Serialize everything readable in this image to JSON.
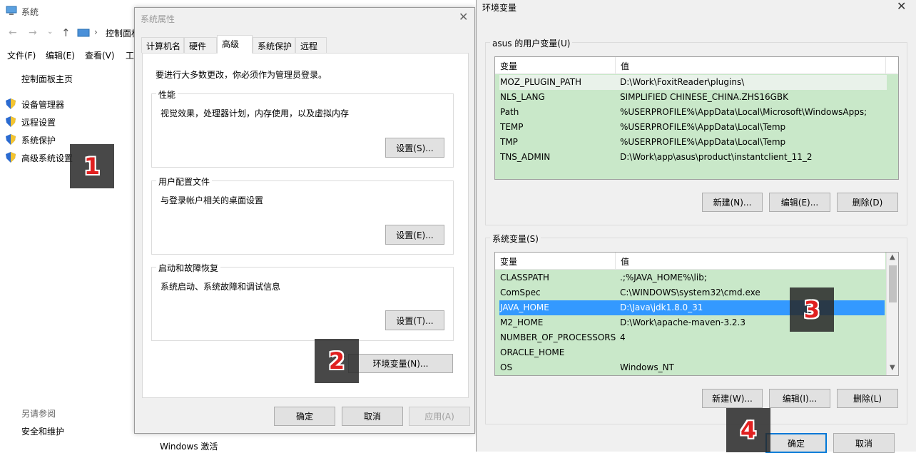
{
  "control_panel": {
    "window_title": "系统",
    "address": "控制面板",
    "menu": [
      "文件(F)",
      "编辑(E)",
      "查看(V)",
      "工"
    ],
    "home_link": "控制面板主页",
    "links": [
      "设备管理器",
      "远程设置",
      "系统保护",
      "高级系统设置"
    ],
    "see_also": "另请参阅",
    "security": "安全和维护",
    "activation": "Windows 激活"
  },
  "system_properties": {
    "title": "系统属性",
    "tabs": [
      "计算机名",
      "硬件",
      "高级",
      "系统保护",
      "远程"
    ],
    "active_tab": "高级",
    "admin_note": "要进行大多数更改，你必须作为管理员登录。",
    "performance": {
      "title": "性能",
      "desc": "视觉效果，处理器计划，内存使用，以及虚拟内存",
      "button": "设置(S)..."
    },
    "user_profile": {
      "title": "用户配置文件",
      "desc": "与登录帐户相关的桌面设置",
      "button": "设置(E)..."
    },
    "startup": {
      "title": "启动和故障恢复",
      "desc": "系统启动、系统故障和调试信息",
      "button": "设置(T)..."
    },
    "env_button": "环境变量(N)...",
    "ok": "确定",
    "cancel": "取消",
    "apply": "应用(A)"
  },
  "env_vars": {
    "title": "环境变量",
    "user_section": "asus 的用户变量(U)",
    "col_var": "变量",
    "col_val": "值",
    "user_rows": [
      {
        "name": "MOZ_PLUGIN_PATH",
        "value": "D:\\Work\\FoxitReader\\plugins\\"
      },
      {
        "name": "NLS_LANG",
        "value": "SIMPLIFIED CHINESE_CHINA.ZHS16GBK"
      },
      {
        "name": "Path",
        "value": "%USERPROFILE%\\AppData\\Local\\Microsoft\\WindowsApps;"
      },
      {
        "name": "TEMP",
        "value": "%USERPROFILE%\\AppData\\Local\\Temp"
      },
      {
        "name": "TMP",
        "value": "%USERPROFILE%\\AppData\\Local\\Temp"
      },
      {
        "name": "TNS_ADMIN",
        "value": "D:\\Work\\app\\asus\\product\\instantclient_11_2"
      }
    ],
    "user_buttons": [
      "新建(N)...",
      "编辑(E)...",
      "删除(D)"
    ],
    "system_section": "系统变量(S)",
    "system_rows": [
      {
        "name": "CLASSPATH",
        "value": ".;%JAVA_HOME%\\lib;"
      },
      {
        "name": "ComSpec",
        "value": "C:\\WINDOWS\\system32\\cmd.exe"
      },
      {
        "name": "JAVA_HOME",
        "value": "D:\\Java\\jdk1.8.0_31"
      },
      {
        "name": "M2_HOME",
        "value": "D:\\Work\\apache-maven-3.2.3"
      },
      {
        "name": "NUMBER_OF_PROCESSORS",
        "value": "4"
      },
      {
        "name": "ORACLE_HOME",
        "value": ""
      },
      {
        "name": "OS",
        "value": "Windows_NT"
      }
    ],
    "selected_system_row": "JAVA_HOME",
    "system_buttons": [
      "新建(W)...",
      "编辑(I)...",
      "删除(L)"
    ],
    "ok": "确定",
    "cancel": "取消"
  },
  "markers": [
    "1",
    "2",
    "3",
    "4"
  ],
  "colors": {
    "list_bg": "#c9e8c9",
    "selection": "#3399ff",
    "primary_border": "#0078d7",
    "marker_text": "#e02020"
  }
}
